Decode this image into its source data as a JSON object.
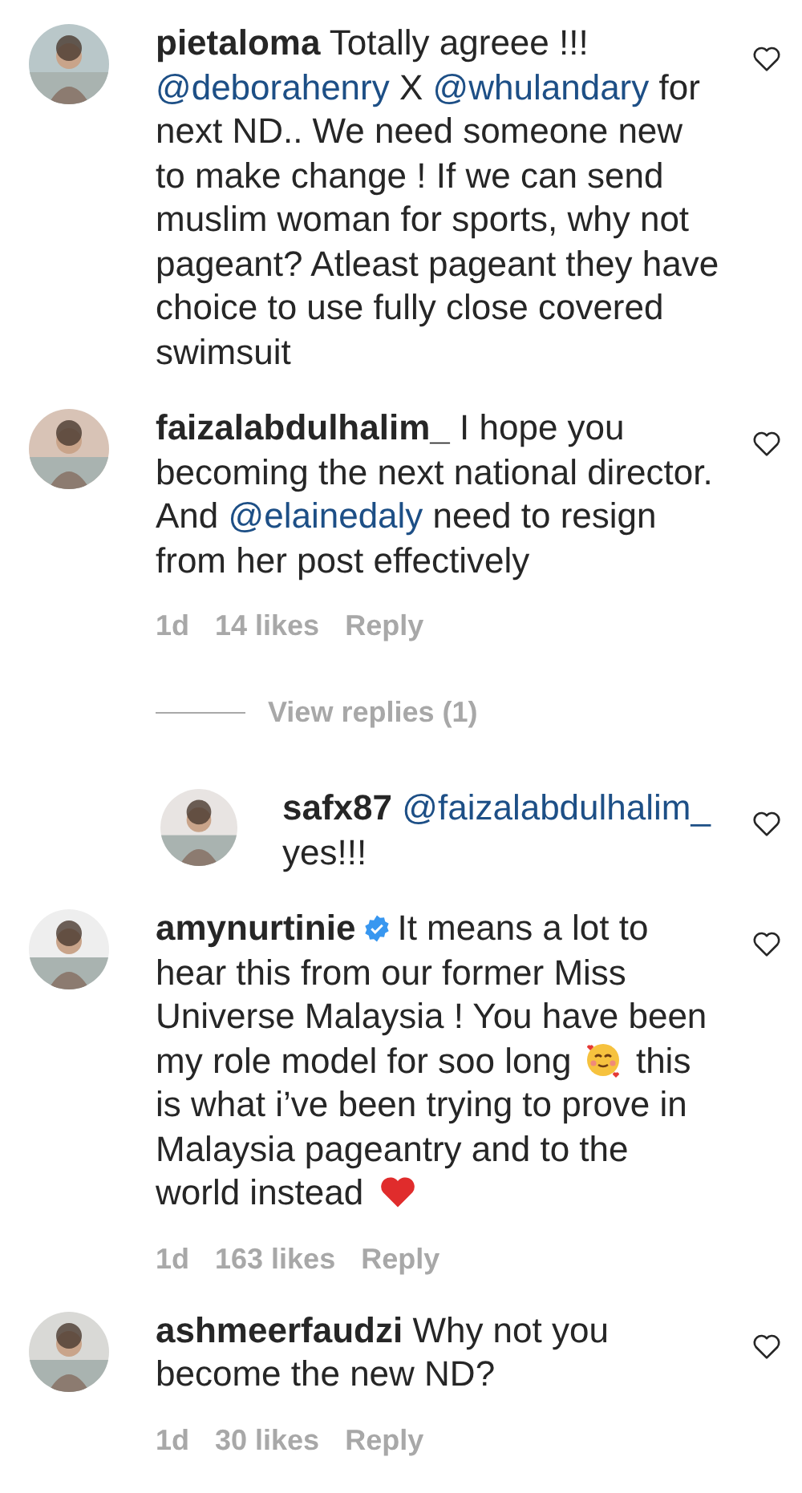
{
  "comments": [
    {
      "username": "pietaloma",
      "verified": false,
      "liked": false,
      "avatar": {
        "kind": "picture"
      },
      "parts": [
        {
          "kind": "text",
          "text": "Totally agreee !!! "
        },
        {
          "kind": "mention",
          "text": "@deborahenry"
        },
        {
          "kind": "text",
          "text": " X "
        },
        {
          "kind": "mention",
          "text": "@whulandary"
        },
        {
          "kind": "text",
          "text": " for next ND.. We need someone new to make change ! If we can send muslim woman for sports, why not pageant? Atleast pageant they have choice to use fully close covered swimsuit"
        }
      ]
    },
    {
      "username": "faizalabdulhalim_",
      "verified": false,
      "liked": false,
      "avatar": {
        "kind": "picture"
      },
      "parts": [
        {
          "kind": "text",
          "text": "I hope you becoming the next national director. And "
        },
        {
          "kind": "mention",
          "text": "@elainedaly"
        },
        {
          "kind": "text",
          "text": " need to resign from her post effectively"
        }
      ],
      "meta": {
        "time": "1d",
        "likes": "14 likes",
        "reply": "Reply"
      },
      "view_replies": "View replies (1)",
      "replies": [
        {
          "username": "safx87",
          "verified": false,
          "liked": false,
          "avatar": {
            "kind": "picture"
          },
          "parts": [
            {
              "kind": "mention",
              "text": "@faizalabdulhalim_"
            },
            {
              "kind": "text",
              "text": " yes!!!"
            }
          ]
        }
      ]
    },
    {
      "username": "amynurtinie",
      "verified": true,
      "liked": false,
      "avatar": {
        "kind": "picture"
      },
      "parts": [
        {
          "kind": "text",
          "text": "It means a lot to hear this from our former Miss Universe Malaysia ! You have been my role model for soo long "
        },
        {
          "kind": "smiling-face-emoji"
        },
        {
          "kind": "text",
          "text": " this is what i’ve been trying to prove in Malaysia pageantry and to the world instead "
        },
        {
          "kind": "heart-emoji"
        }
      ],
      "meta": {
        "time": "1d",
        "likes": "163 likes",
        "reply": "Reply"
      }
    },
    {
      "username": "ashmeerfaudzi",
      "verified": false,
      "liked": false,
      "avatar": {
        "kind": "picture"
      },
      "parts": [
        {
          "kind": "text",
          "text": "Why not you become the new ND?"
        }
      ],
      "meta": {
        "time": "1d",
        "likes": "30 likes",
        "reply": "Reply"
      }
    }
  ]
}
